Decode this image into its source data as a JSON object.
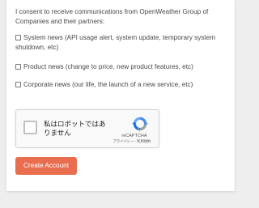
{
  "consent": {
    "intro": "I consent to receive communications from OpenWeather Group of Companies and their partners:",
    "options": [
      {
        "label": "System news (API usage alert, system update, temporary system shutdown, etc)",
        "checked": false
      },
      {
        "label": "Product news (change to price, new product features, etc)",
        "checked": false
      },
      {
        "label": "Corporate news (our life, the launch of a new service, etc)",
        "checked": false
      }
    ]
  },
  "captcha": {
    "label": "私はロボットではありません",
    "brand": "reCAPTCHA",
    "links": "プライバシー - 利用規約",
    "checked": false
  },
  "form": {
    "submit_label": "Create Account",
    "submit_color": "#e96e50"
  }
}
